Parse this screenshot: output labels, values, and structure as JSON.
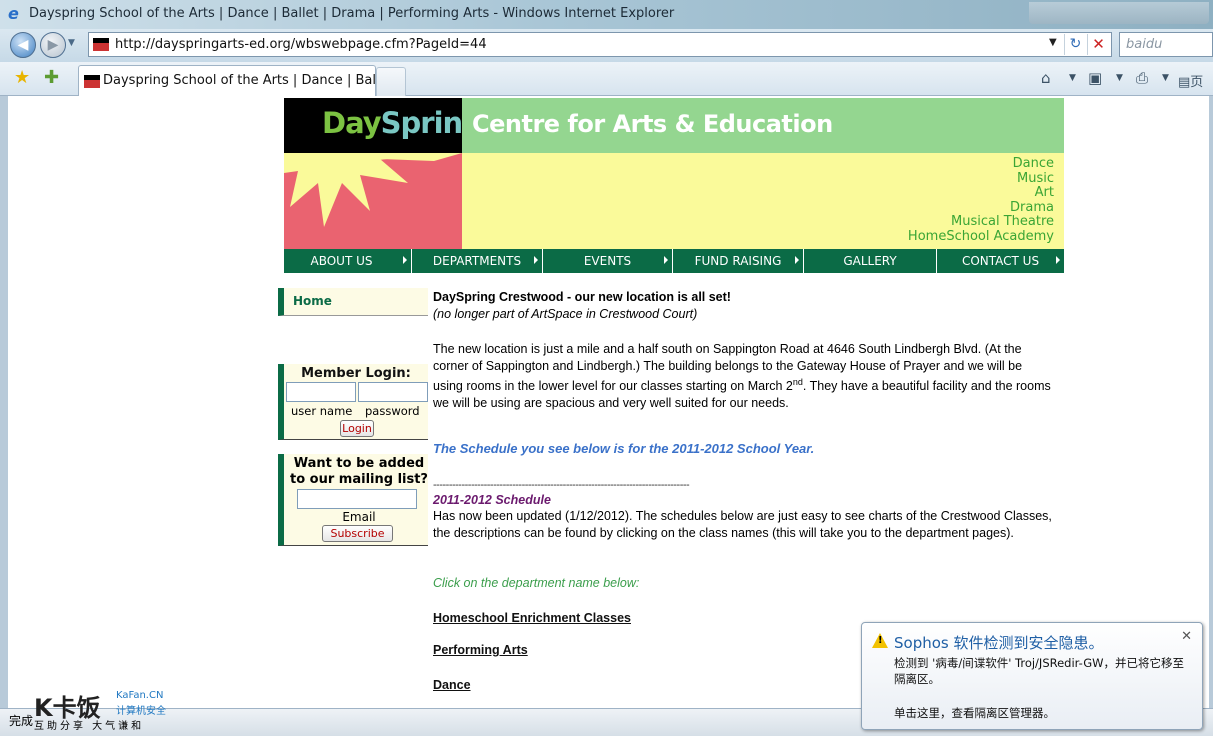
{
  "window": {
    "title": "Dayspring School of the Arts | Dance | Ballet | Drama | Performing Arts - Windows Internet Explorer"
  },
  "browser": {
    "address_url": "http://dayspringarts-ed.org/wbswebpage.cfm?PageId=44",
    "search_placeholder": "baidu",
    "tab_title": "Dayspring School of the Arts | Dance | Ballet...",
    "tab_toolbar_label": "页"
  },
  "header": {
    "logo_day": "Day",
    "logo_spring": "Spring",
    "centre_title": "Centre for Arts & Education",
    "departments": [
      "Dance",
      "Music",
      "Art",
      "Drama",
      "Musical Theatre",
      "HomeSchool Academy"
    ]
  },
  "menu": [
    {
      "label": "ABOUT US",
      "has_submenu": true
    },
    {
      "label": "DEPARTMENTS",
      "has_submenu": true
    },
    {
      "label": "EVENTS",
      "has_submenu": true
    },
    {
      "label": "FUND RAISING",
      "has_submenu": true
    },
    {
      "label": "GALLERY",
      "has_submenu": false
    },
    {
      "label": "CONTACT US",
      "has_submenu": true
    }
  ],
  "sidebar": {
    "home_label": "Home",
    "login": {
      "heading": "Member Login:",
      "user_label": "user name",
      "password_label": "password",
      "button_label": "Login"
    },
    "mailing": {
      "heading": "Want to be added to our mailing list?",
      "email_label": "Email",
      "button_label": "Subscribe"
    }
  },
  "content": {
    "title": "DaySpring Crestwood  - our new location is all set!",
    "subtitle": "(no longer part of ArtSpace in Crestwood Court)",
    "para1_pre": "The new location is just a mile and a half south on Sappington Road at 4646 South Lindbergh Blvd. (At the corner of Sappington and Lindbergh.) The building belongs to the Gateway House of Prayer and we will be using rooms in the lower level for our classes starting on March 2",
    "para1_sup": "nd",
    "para1_post": ". They have a beautiful facility and the rooms we will be using are spacious and very well suited for our needs.",
    "schedule_note": "The Schedule you see below is for the 2011-2012 School Year.",
    "divider": "---------------------------------------------------------------------------------",
    "schedule_heading": "2011-2012 Schedule",
    "para2": "Has now been updated (1/12/2012).  The schedules below are just easy to see charts of the Crestwood Classes, the descriptions can be found by clicking on the class names (this will take you to the department pages).",
    "click_note": "Click on the department name below:",
    "links": [
      "Homeschool Enrichment Classes",
      "Performing Arts",
      "Dance"
    ]
  },
  "status": {
    "done_label": "完成"
  },
  "watermark": {
    "brand": "K卡饭",
    "site": "KaFan.CN",
    "tagline": "计算机安全",
    "footer": "互助分享  大气谦和"
  },
  "popup": {
    "title": "Sophos 软件检测到安全隐患。",
    "body": "检测到 '病毒/间谍软件' Troj/JSRedir-GW，并已将它移至隔离区。",
    "action": "单击这里，查看隔离区管理器。"
  }
}
